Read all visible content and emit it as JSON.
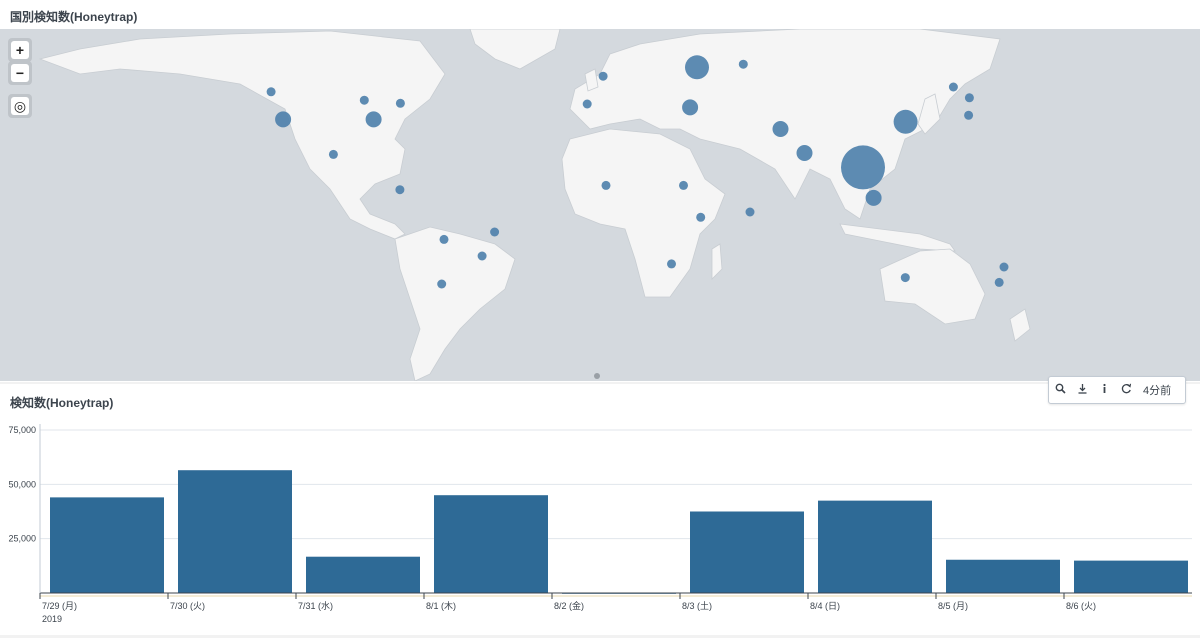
{
  "map_panel": {
    "title": "国別検知数(Honeytrap)"
  },
  "map_controls": {
    "zoom_in": "+",
    "zoom_out": "−",
    "locate": "◎"
  },
  "colors": {
    "bubble": "#4f81ab",
    "land": "#f5f5f5",
    "water": "#d4d9de",
    "bar": "#2e6a96"
  },
  "map_points": [
    {
      "lon": -122.5,
      "lat": 45.5,
      "size": "small"
    },
    {
      "lon": -118.0,
      "lat": 34.0,
      "size": "medium"
    },
    {
      "lon": -84.0,
      "lat": 34.0,
      "size": "medium"
    },
    {
      "lon": -87.5,
      "lat": 42.0,
      "size": "small"
    },
    {
      "lon": -73.9,
      "lat": 40.7,
      "size": "small"
    },
    {
      "lon": -99.1,
      "lat": 19.4,
      "size": "small"
    },
    {
      "lon": -74.1,
      "lat": 4.7,
      "size": "small"
    },
    {
      "lon": -57.5,
      "lat": -16.0,
      "size": "small"
    },
    {
      "lon": -43.2,
      "lat": -22.9,
      "size": "small"
    },
    {
      "lon": -38.5,
      "lat": -12.9,
      "size": "small"
    },
    {
      "lon": -58.4,
      "lat": -34.6,
      "size": "small"
    },
    {
      "lon": 2.3,
      "lat": 52.0,
      "size": "small"
    },
    {
      "lon": -3.7,
      "lat": 40.4,
      "size": "small"
    },
    {
      "lon": 37.6,
      "lat": 55.7,
      "size": "large"
    },
    {
      "lon": 55.0,
      "lat": 57.0,
      "size": "small"
    },
    {
      "lon": 35.0,
      "lat": 39.0,
      "size": "medium"
    },
    {
      "lon": 69.0,
      "lat": 30.0,
      "size": "medium"
    },
    {
      "lon": 78.0,
      "lat": 20.0,
      "size": "medium"
    },
    {
      "lon": 100.0,
      "lat": 14.0,
      "size": "xlarge"
    },
    {
      "lon": 116.0,
      "lat": 33.0,
      "size": "large"
    },
    {
      "lon": 104.0,
      "lat": 1.3,
      "size": "medium"
    },
    {
      "lon": 134.0,
      "lat": 47.5,
      "size": "small"
    },
    {
      "lon": 139.7,
      "lat": 35.7,
      "size": "small"
    },
    {
      "lon": 140.0,
      "lat": 43.0,
      "size": "small"
    },
    {
      "lon": 3.4,
      "lat": 6.5,
      "size": "small"
    },
    {
      "lon": 32.5,
      "lat": 6.5,
      "size": "small"
    },
    {
      "lon": 39.0,
      "lat": -6.8,
      "size": "small"
    },
    {
      "lon": 28.0,
      "lat": -26.2,
      "size": "small"
    },
    {
      "lon": 57.5,
      "lat": -4.6,
      "size": "small"
    },
    {
      "lon": 115.9,
      "lat": -31.9,
      "size": "small"
    },
    {
      "lon": 153.0,
      "lat": -27.5,
      "size": "small"
    },
    {
      "lon": 151.2,
      "lat": -33.9,
      "size": "small"
    }
  ],
  "toolbar": {
    "search_icon": "search-icon",
    "export_icon": "download-icon",
    "inspect_icon": "info-icon",
    "refresh_icon": "refresh-icon",
    "time_label": "4分前"
  },
  "bar_panel": {
    "title": "検知数(Honeytrap)"
  },
  "chart_data": {
    "type": "bar",
    "categories": [
      "7/29 (月)",
      "7/30 (火)",
      "7/31 (水)",
      "8/1 (木)",
      "8/2 (金)",
      "8/3 (土)",
      "8/4 (日)",
      "8/5 (月)",
      "8/6 (火)"
    ],
    "year_label": "2019",
    "values": [
      44000,
      56500,
      16700,
      45000,
      0,
      37500,
      42500,
      15300,
      14900
    ],
    "ylim": [
      0,
      75000
    ],
    "yticks": [
      25000,
      50000,
      75000
    ],
    "ytick_labels": [
      "25,000",
      "50,000",
      "75,000"
    ],
    "xlabel": "",
    "ylabel": "",
    "grid": true
  }
}
